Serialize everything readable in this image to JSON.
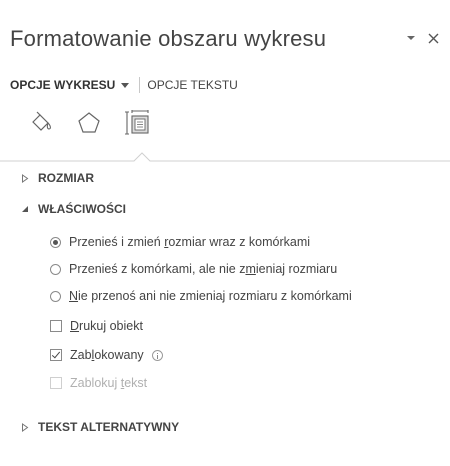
{
  "pane": {
    "title": "Formatowanie obszaru wykresu",
    "dropdown_icon": "dropdown-arrow-icon",
    "close_icon": "close-icon"
  },
  "tabs": [
    {
      "label": "OPCJE WYKRESU",
      "active": true
    },
    {
      "label": "OPCJE TEKSTU",
      "active": false
    }
  ],
  "category_icons": [
    "fill-line-icon",
    "effects-icon",
    "size-properties-icon"
  ],
  "sections": {
    "size": {
      "label": "ROZMIAR",
      "expanded": false
    },
    "properties": {
      "label": "WŁAŚCIWOŚCI",
      "expanded": true
    },
    "alt_text": {
      "label": "TEKST ALTERNATYWNY",
      "expanded": false
    }
  },
  "properties": {
    "radio_options": [
      {
        "pre": "Przenieś i zmień ",
        "key": "r",
        "post": "ozmiar wraz z komórkami",
        "checked": true
      },
      {
        "pre": "Przenieś z komórkami, ale nie z",
        "key": "m",
        "post": "ieniaj rozmiaru",
        "checked": false
      },
      {
        "pre": "",
        "key": "N",
        "post": "ie przenoś ani nie zmieniaj rozmiaru z komórkami",
        "checked": false
      }
    ],
    "checkboxes": [
      {
        "pre": "",
        "key": "D",
        "post": "rukuj obiekt",
        "checked": false,
        "disabled": false
      },
      {
        "pre": "Zab",
        "key": "l",
        "post": "okowany",
        "checked": true,
        "disabled": false
      },
      {
        "pre": "Zablokuj ",
        "key": "t",
        "post": "ekst",
        "checked": false,
        "disabled": true
      }
    ]
  },
  "colors": {
    "text": "#444444",
    "disabled_text": "#b0b0b0",
    "divider": "#d0d0d0"
  }
}
